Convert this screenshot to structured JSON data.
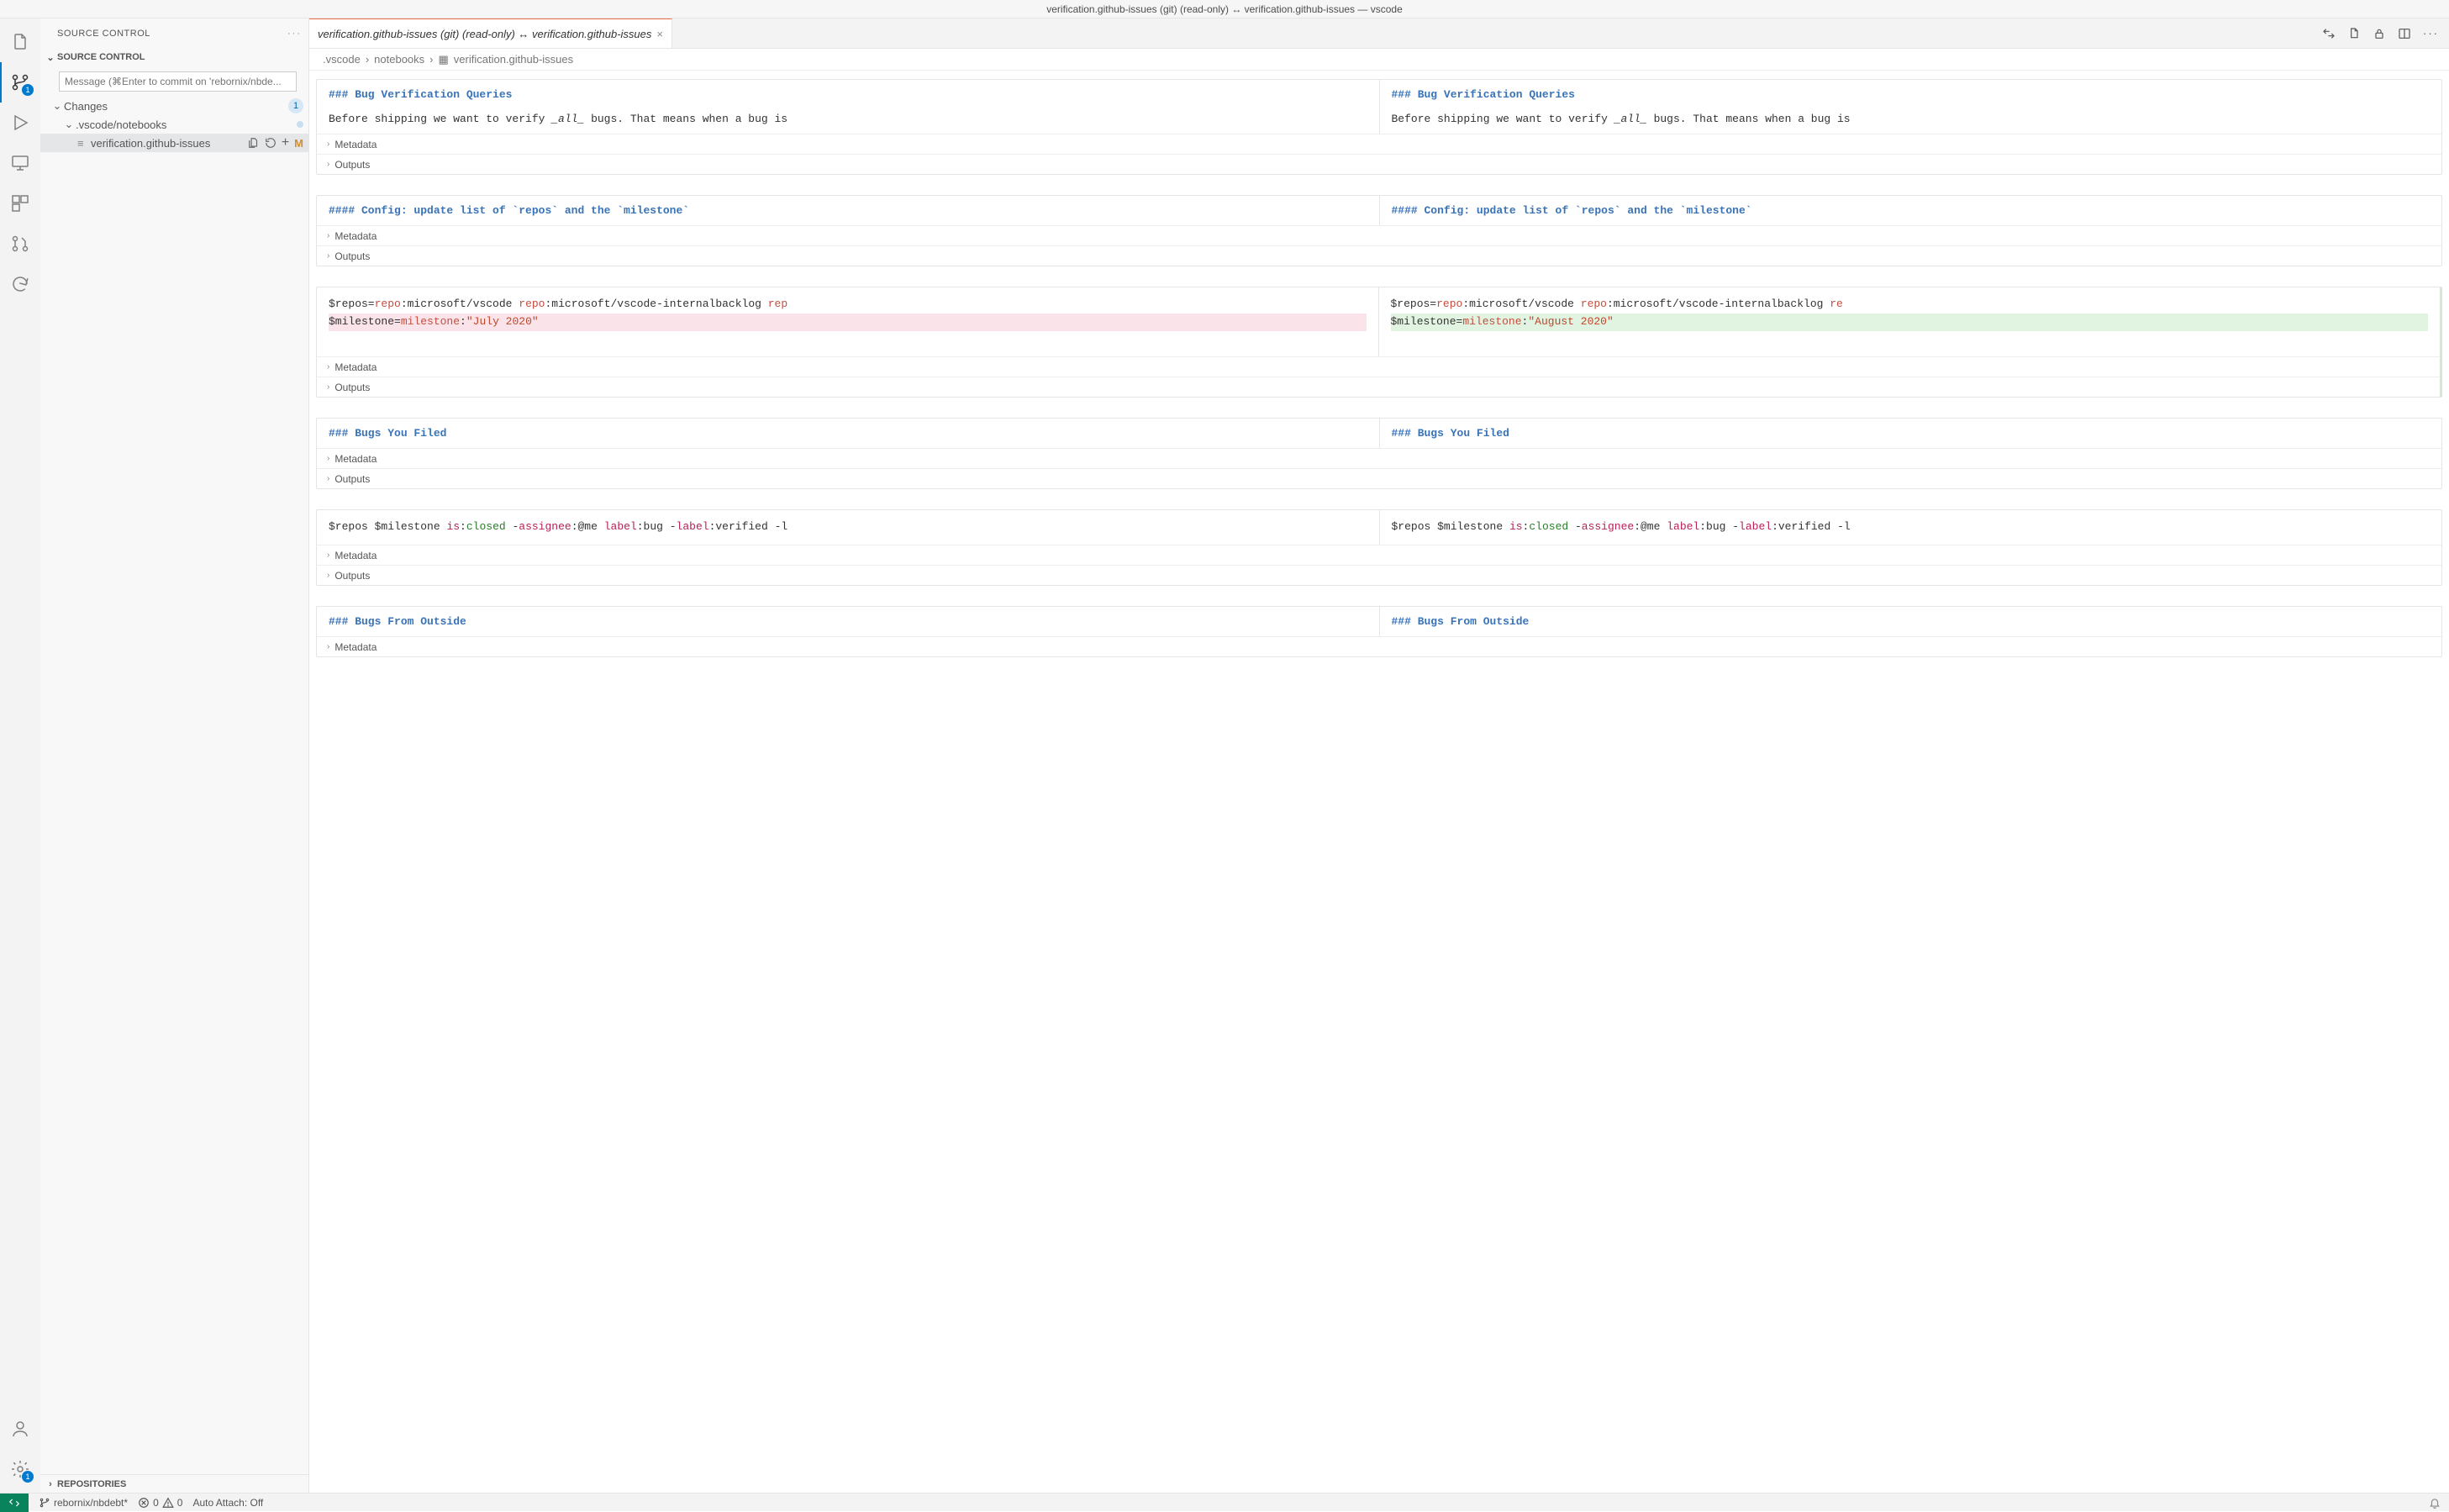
{
  "window_title": "verification.github-issues (git) (read-only) ↔ verification.github-issues — vscode",
  "activity": {
    "scm_badge": "1",
    "settings_badge": "1"
  },
  "sidebar": {
    "title": "SOURCE CONTROL",
    "sections": {
      "scm_header": "SOURCE CONTROL",
      "repositories_header": "REPOSITORIES"
    },
    "commit_placeholder": "Message (⌘Enter to commit on 'rebornix/nbde...",
    "changes": {
      "label": "Changes",
      "count": "1",
      "folder": ".vscode/notebooks",
      "file": "verification.github-issues",
      "file_status": "M"
    }
  },
  "tab": {
    "label": "verification.github-issues (git) (read-only) ↔ verification.github-issues"
  },
  "breadcrumbs": [
    ".vscode",
    "notebooks",
    "verification.github-issues"
  ],
  "cells": [
    {
      "type": "md",
      "left_head": "### Bug Verification Queries",
      "right_head": "### Bug Verification Queries",
      "left_body_prefix": "Before shipping we want to verify ",
      "left_body_em": "_all_",
      "left_body_suffix": " bugs. That means when a bug is",
      "right_body_prefix": "Before shipping we want to verify ",
      "right_body_em": "_all_",
      "right_body_suffix": " bugs. That means when a bug is",
      "folds": [
        "Metadata",
        "Outputs"
      ]
    },
    {
      "type": "md",
      "left_head": "#### Config: update list of `repos` and the `milestone`",
      "right_head": "#### Config: update list of `repos` and the `milestone`",
      "folds": [
        "Metadata",
        "Outputs"
      ]
    },
    {
      "type": "code_diff",
      "left_lines": [
        {
          "cls": "",
          "html": "$repos=<span class='kw-repo'>repo</span>:microsoft/vscode <span class='kw-repo'>repo</span>:microsoft/vscode-internalbacklog <span class='kw-repo'>rep</span>"
        },
        {
          "cls": "deleted",
          "html": "$milestone=<span class='kw-mil'>milestone</span>:<span class='kw-str'>\"July 2020\"</span>"
        }
      ],
      "right_lines": [
        {
          "cls": "",
          "html": "$repos=<span class='kw-repo'>repo</span>:microsoft/vscode <span class='kw-repo'>repo</span>:microsoft/vscode-internalbacklog <span class='kw-repo'>re</span>"
        },
        {
          "cls": "added",
          "html": "$milestone=<span class='kw-mil'>milestone</span>:<span class='kw-str'>\"August 2020\"</span>"
        }
      ],
      "folds": [
        "Metadata",
        "Outputs"
      ]
    },
    {
      "type": "md",
      "left_head": "### Bugs You Filed",
      "right_head": "### Bugs You Filed",
      "folds": [
        "Metadata",
        "Outputs"
      ]
    },
    {
      "type": "code_same",
      "left_html": "$repos $milestone <span class='kw-is'>is</span>:<span class='kw-closed'>closed</span> -<span class='kw-assignee'>assignee</span>:@me <span class='kw-label'>label</span>:bug -<span class='kw-label'>label</span>:verified -l",
      "right_html": "$repos $milestone <span class='kw-is'>is</span>:<span class='kw-closed'>closed</span> -<span class='kw-assignee'>assignee</span>:@me <span class='kw-label'>label</span>:bug -<span class='kw-label'>label</span>:verified -l",
      "folds": [
        "Metadata",
        "Outputs"
      ]
    },
    {
      "type": "md",
      "left_head": "### Bugs From Outside",
      "right_head": "### Bugs From Outside",
      "folds": [
        "Metadata"
      ]
    }
  ],
  "statusbar": {
    "branch": "rebornix/nbdebt*",
    "errors": "0",
    "warnings": "0",
    "auto_attach": "Auto Attach: Off"
  }
}
